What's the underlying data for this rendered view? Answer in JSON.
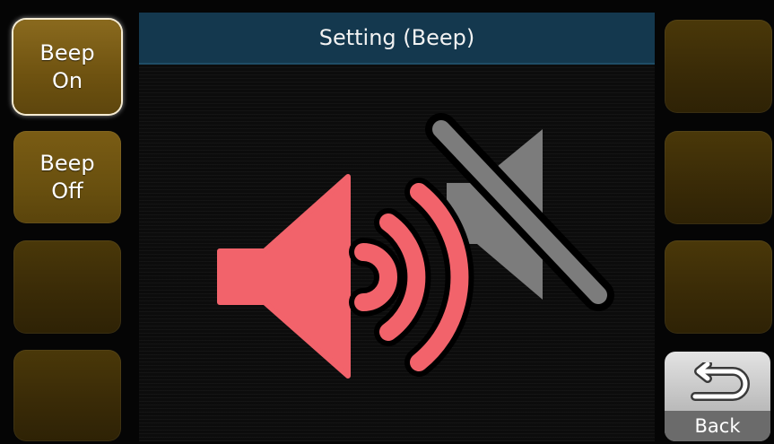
{
  "title": "Setting (Beep)",
  "left_buttons": [
    {
      "label": "Beep\nOn",
      "state": "selected"
    },
    {
      "label": "Beep\nOff",
      "state": "enabled"
    },
    {
      "label": "",
      "state": "empty"
    },
    {
      "label": "",
      "state": "empty"
    }
  ],
  "right_buttons": [
    {
      "label": "",
      "state": "empty"
    },
    {
      "label": "",
      "state": "empty"
    },
    {
      "label": "",
      "state": "empty"
    }
  ],
  "back": {
    "label": "Back",
    "icon": "return-arrow-icon"
  },
  "illustration": {
    "beep_on_icon": "speaker-sound-icon",
    "beep_off_icon": "speaker-muted-icon",
    "colors": {
      "on": "#f2636b",
      "off": "#7c7c7c"
    }
  },
  "colors": {
    "title_bar": "#14384e",
    "button_gold": "#6e5210",
    "button_dark": "#3a2b07",
    "back_button": "#bdbdbd"
  }
}
